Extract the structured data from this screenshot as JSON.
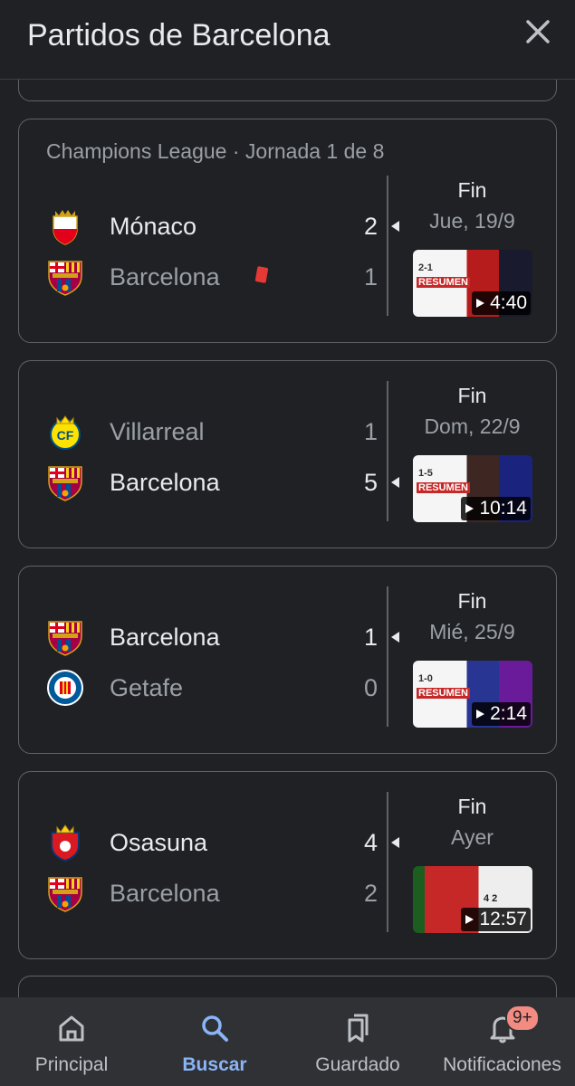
{
  "header": {
    "title": "Partidos de Barcelona"
  },
  "matches": [
    {
      "competition": "Champions League · Jornada 1 de 8",
      "home": {
        "name": "Mónaco",
        "score": "2",
        "winner": true
      },
      "away": {
        "name": "Barcelona",
        "score": "1",
        "winner": false,
        "red_card": true
      },
      "status": "Fin",
      "date": "Jue, 19/9",
      "video_duration": "4:40",
      "thumb_score": "2-1",
      "thumb_title": "RESUMEN"
    },
    {
      "competition": "",
      "home": {
        "name": "Villarreal",
        "score": "1",
        "winner": false
      },
      "away": {
        "name": "Barcelona",
        "score": "5",
        "winner": true
      },
      "status": "Fin",
      "date": "Dom, 22/9",
      "video_duration": "10:14",
      "thumb_score": "1-5",
      "thumb_title": "RESUMEN"
    },
    {
      "competition": "",
      "home": {
        "name": "Barcelona",
        "score": "1",
        "winner": true
      },
      "away": {
        "name": "Getafe",
        "score": "0",
        "winner": false
      },
      "status": "Fin",
      "date": "Mié, 25/9",
      "video_duration": "2:14",
      "thumb_score": "1-0",
      "thumb_title": "RESUMEN"
    },
    {
      "competition": "",
      "home": {
        "name": "Osasuna",
        "score": "4",
        "winner": true
      },
      "away": {
        "name": "Barcelona",
        "score": "2",
        "winner": false
      },
      "status": "Fin",
      "date": "Ayer",
      "video_duration": "12:57",
      "thumb_score": "4 2",
      "thumb_title": ""
    }
  ],
  "nav": {
    "items": [
      {
        "label": "Principal",
        "icon": "home-icon"
      },
      {
        "label": "Buscar",
        "icon": "search-icon",
        "active": true
      },
      {
        "label": "Guardado",
        "icon": "bookmarks-icon"
      },
      {
        "label": "Notificaciones",
        "icon": "bell-icon",
        "badge": "9+"
      }
    ]
  },
  "colors": {
    "background": "#202124",
    "card_border": "#5f6368",
    "text_primary": "#e8eaed",
    "text_secondary": "#9aa0a6",
    "accent": "#8ab4f8",
    "badge": "#f28b82",
    "red_card": "#e53935"
  }
}
